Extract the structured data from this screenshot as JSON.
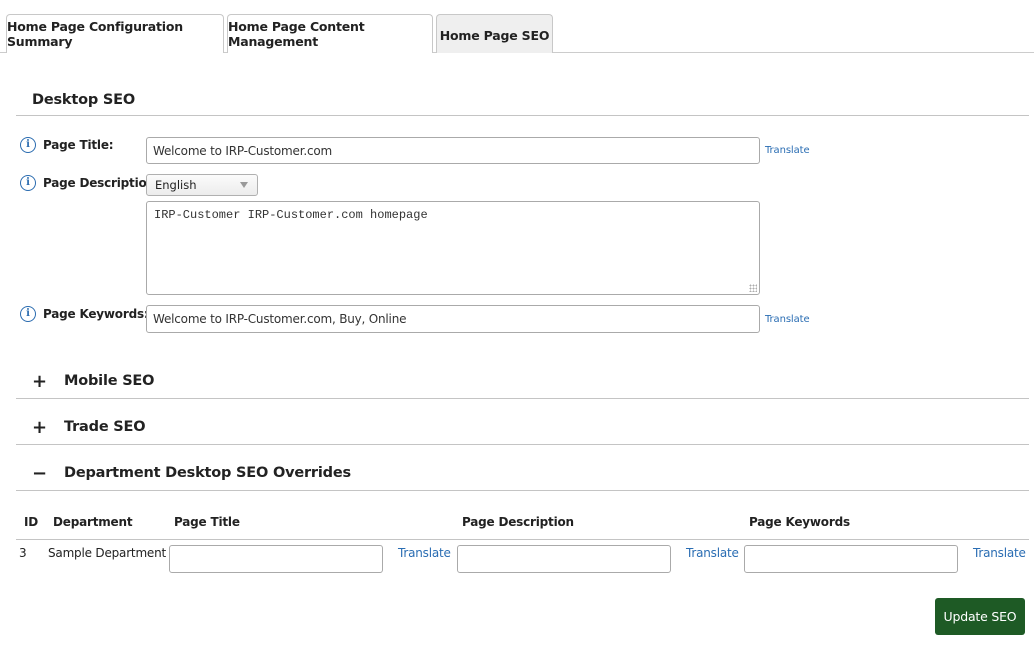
{
  "tabs": [
    {
      "label": "Home Page Configuration Summary",
      "active": false
    },
    {
      "label": "Home Page Content Management",
      "active": false
    },
    {
      "label": "Home Page SEO",
      "active": true
    }
  ],
  "desktop_seo": {
    "title": "Desktop SEO",
    "page_title": {
      "label": "Page Title:",
      "value": "Welcome to IRP-Customer.com",
      "translate": "Translate",
      "icon": "info-icon"
    },
    "page_description": {
      "label": "Page Description:",
      "language": "English",
      "value": "IRP-Customer IRP-Customer.com homepage",
      "icon": "info-icon"
    },
    "page_keywords": {
      "label": "Page Keywords:",
      "value": "Welcome to IRP-Customer.com, Buy, Online",
      "translate": "Translate",
      "icon": "info-icon"
    }
  },
  "sections": [
    {
      "title": "Mobile SEO",
      "toggle": "+",
      "expanded": false
    },
    {
      "title": "Trade SEO",
      "toggle": "+",
      "expanded": false
    },
    {
      "title": "Department Desktop SEO Overrides",
      "toggle": "−",
      "expanded": true
    }
  ],
  "department_table": {
    "headers": [
      "ID",
      "Department",
      "Page Title",
      "Page Description",
      "Page Keywords"
    ],
    "rows": [
      {
        "id": "3",
        "department": "Sample Department",
        "page_title": "",
        "page_description": "",
        "page_keywords": "",
        "translate": "Translate"
      }
    ]
  },
  "actions": {
    "update_label": "Update SEO",
    "update_color": "#1e5a25"
  },
  "colors": {
    "link": "#2a6db3",
    "info_icon": "#2b6cb0"
  }
}
